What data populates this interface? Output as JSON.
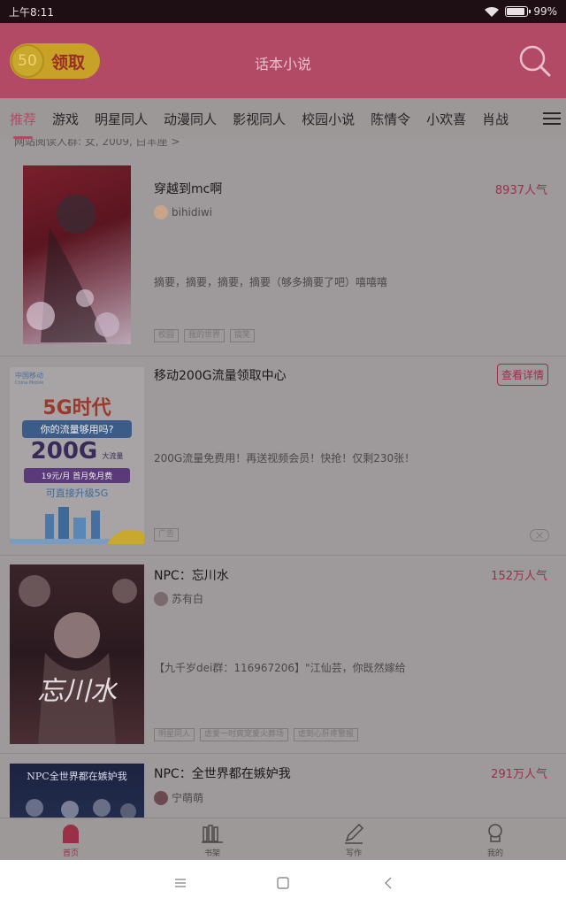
{
  "status": {
    "time": "上午8:11",
    "battery": "99%"
  },
  "header": {
    "coin_value": "50",
    "coin_label": "领取",
    "title": "话本小说"
  },
  "tabs": [
    "推荐",
    "游戏",
    "明星同人",
    "动漫同人",
    "影视同人",
    "校园小说",
    "陈情令",
    "小欢喜",
    "肖战"
  ],
  "prev_snippet": "网站阅读人群: 女, 2009, 白羊座 >",
  "cards": [
    {
      "title": "穿越到mc啊",
      "heat": "8937人气",
      "author": "bihidiwi",
      "summary": "摘要，摘要，摘要，摘要（够多摘要了吧）嘻嘻嘻",
      "tags": [
        "校园",
        "我的世界",
        "搞笑"
      ]
    },
    {
      "title": "移动200G流量领取中心",
      "button": "查看详情",
      "summary": "200G流量免费用！再送视频会员！快抢！仅剩230张！",
      "ad_label": "广告",
      "ad_cover": {
        "brand": "中国移动",
        "brand_en": "China Mobile",
        "headline": "5G时代",
        "question": "你的流量够用吗?",
        "big": "200G",
        "big_suffix": "大流量",
        "price": "19元/月",
        "price_note": "首月免月费",
        "slogan": "可直接升级5G"
      }
    },
    {
      "title": "NPC：忘川水",
      "heat": "152万人气",
      "author": "苏有白",
      "summary": "【九千岁dei群：116967206】\"江仙芸，你既然嫁给",
      "tags": [
        "明星同人",
        "虐爱一时爽宠爱火葬场",
        "虐到心肝疼警报"
      ],
      "cover_text": "忘川水"
    },
    {
      "title": "NPC：全世界都在嫉妒我",
      "heat": "291万人气",
      "author": "宁萌萌",
      "cover_text": "NPC全世界都在嫉妒我"
    }
  ],
  "nav": [
    "首页",
    "书架",
    "写作",
    "我的"
  ],
  "colors": {
    "accent": "#b34a65",
    "header": "#b34a65",
    "overlay": "#9e9a9b"
  }
}
